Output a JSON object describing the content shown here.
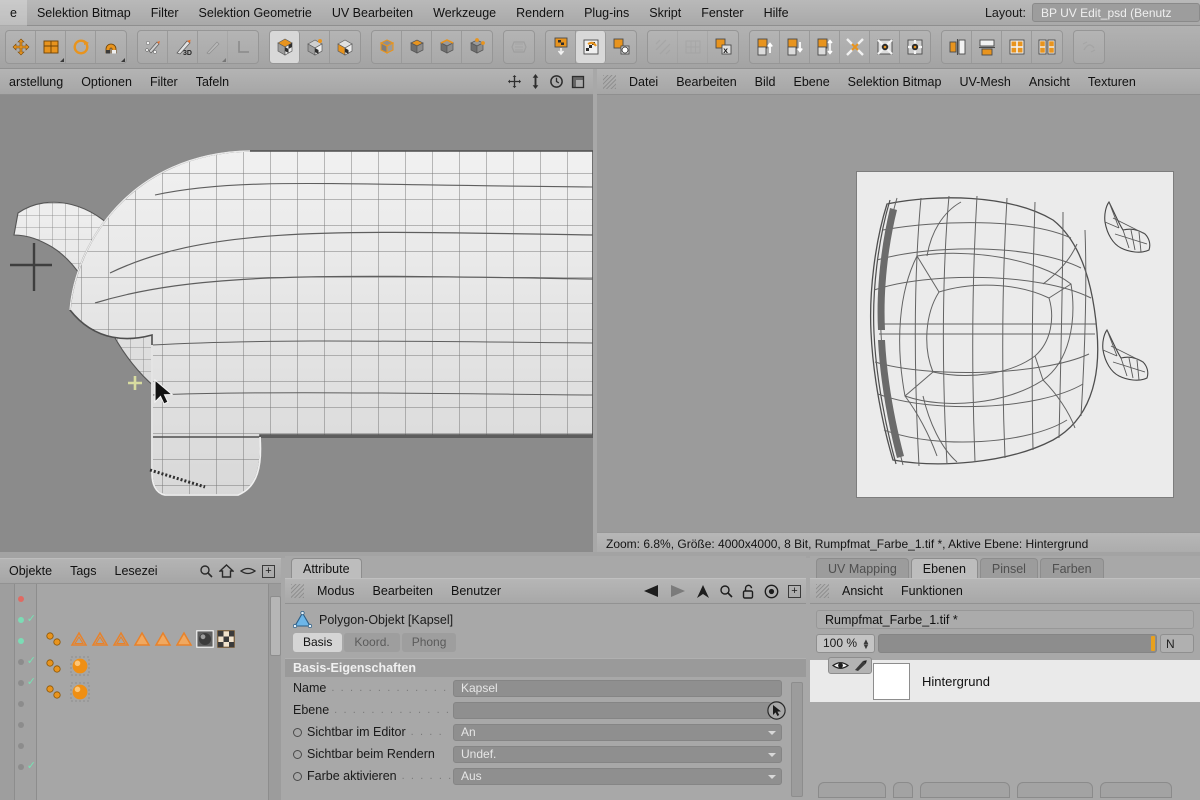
{
  "app": {
    "layout_label": "Layout:",
    "layout_value": "BP UV Edit_psd (Benutz"
  },
  "top_menu": {
    "items": [
      {
        "label": "e",
        "name": "menu-datei-truncated"
      },
      {
        "label": "Selektion Bitmap",
        "name": "menu-selektion-bitmap"
      },
      {
        "label": "Filter",
        "name": "menu-filter"
      },
      {
        "label": "Selektion Geometrie",
        "name": "menu-selektion-geometrie"
      },
      {
        "label": "UV Bearbeiten",
        "name": "menu-uv-bearbeiten"
      },
      {
        "label": "Werkzeuge",
        "name": "menu-werkzeuge"
      },
      {
        "label": "Rendern",
        "name": "menu-rendern"
      },
      {
        "label": "Plug-ins",
        "name": "menu-plugins"
      },
      {
        "label": "Skript",
        "name": "menu-skript"
      },
      {
        "label": "Fenster",
        "name": "menu-fenster"
      },
      {
        "label": "Hilfe",
        "name": "menu-hilfe"
      }
    ]
  },
  "icon_toolbar": {
    "groups": [
      {
        "name": "transform-tools",
        "buttons": [
          {
            "name": "move-tool-icon",
            "glyph": "move",
            "active": false
          },
          {
            "name": "scale-tool-icon",
            "glyph": "scale",
            "active": false,
            "corner": true
          },
          {
            "name": "rotate-tool-icon",
            "glyph": "rotate",
            "active": false
          },
          {
            "name": "magnet-tool-icon",
            "glyph": "magnet",
            "active": false,
            "corner": true
          }
        ]
      },
      {
        "name": "paint-tools",
        "buttons": [
          {
            "name": "selection-brush-icon",
            "glyph": "selbrush",
            "active": false
          },
          {
            "name": "paint-3d-brush-icon",
            "glyph": "brush3d",
            "active": false
          },
          {
            "name": "smudge-tool-icon",
            "glyph": "smudge",
            "active": false,
            "dim": true,
            "corner": true
          },
          {
            "name": "axis-tool-icon",
            "glyph": "axis",
            "active": false
          }
        ]
      },
      {
        "name": "uv-mode-tools",
        "buttons": [
          {
            "name": "texture-mode-icon",
            "glyph": "cubecheck-a",
            "active": true
          },
          {
            "name": "uv-polygon-mode-icon",
            "glyph": "cubecheck-b",
            "active": false
          },
          {
            "name": "uv-point-mode-icon",
            "glyph": "cubecheck-c",
            "active": false
          }
        ]
      },
      {
        "name": "component-mode-tools",
        "buttons": [
          {
            "name": "model-mode-icon",
            "glyph": "cube-model",
            "active": false
          },
          {
            "name": "polygon-mode-icon",
            "glyph": "cube-poly",
            "active": false
          },
          {
            "name": "edge-mode-icon",
            "glyph": "cube-edge",
            "active": false
          },
          {
            "name": "point-mode-icon",
            "glyph": "cube-point",
            "active": false
          }
        ]
      },
      {
        "name": "uv-mesh-tool",
        "buttons": [
          {
            "name": "uv-mesh-icon",
            "glyph": "uvmesh",
            "active": false,
            "dim": true
          }
        ]
      },
      {
        "name": "texture-apply-tools",
        "buttons": [
          {
            "name": "apply-texture-icon",
            "glyph": "apply-down",
            "active": false
          },
          {
            "name": "texture-swap-icon",
            "glyph": "tex-swap",
            "active": true
          },
          {
            "name": "texture-recycle-icon",
            "glyph": "tex-recycle",
            "active": false
          }
        ]
      },
      {
        "name": "layer-tools",
        "buttons": [
          {
            "name": "layer-pattern-icon",
            "glyph": "pattern",
            "active": false,
            "dim": true
          },
          {
            "name": "layer-grid-icon",
            "glyph": "grid",
            "active": false,
            "dim": true
          },
          {
            "name": "layer-delete-icon",
            "glyph": "layer-x",
            "active": false
          }
        ]
      },
      {
        "name": "uv-arrange-tools",
        "buttons": [
          {
            "name": "uv-move-up-icon",
            "glyph": "arr-up",
            "active": false
          },
          {
            "name": "uv-move-down-icon",
            "glyph": "arr-down",
            "active": false
          },
          {
            "name": "uv-move-updown-icon",
            "glyph": "arr-updown",
            "active": false
          },
          {
            "name": "uv-collapse-icon",
            "glyph": "collapse",
            "active": false
          },
          {
            "name": "uv-relax-icon",
            "glyph": "relax-a",
            "active": false
          },
          {
            "name": "uv-optimal-icon",
            "glyph": "relax-b",
            "active": false
          }
        ]
      },
      {
        "name": "uv-align-tools",
        "buttons": [
          {
            "name": "align-horizontal-icon",
            "glyph": "align-h",
            "active": false
          },
          {
            "name": "align-vertical-icon",
            "glyph": "align-v",
            "active": false
          },
          {
            "name": "distribute-grid-icon",
            "glyph": "dist-grid",
            "active": false
          },
          {
            "name": "distribute-columns-icon",
            "glyph": "dist-col",
            "active": false
          }
        ]
      },
      {
        "name": "uv-extras",
        "buttons": [
          {
            "name": "uv-extra-icon",
            "glyph": "extra",
            "active": false,
            "dim": true
          }
        ]
      }
    ]
  },
  "viewport": {
    "menu": [
      {
        "label": "arstellung",
        "name": "viewport-menu-darstellung"
      },
      {
        "label": "Optionen",
        "name": "viewport-menu-optionen"
      },
      {
        "label": "Filter",
        "name": "viewport-menu-filter"
      },
      {
        "label": "Tafeln",
        "name": "viewport-menu-tafeln"
      }
    ],
    "nav_icons": [
      {
        "name": "pan-viewport-icon"
      },
      {
        "name": "dolly-viewport-icon"
      },
      {
        "name": "rotate-viewport-icon"
      },
      {
        "name": "maximize-viewport-icon"
      }
    ]
  },
  "uv_editor": {
    "menu": [
      {
        "label": "Datei",
        "name": "uv-menu-datei"
      },
      {
        "label": "Bearbeiten",
        "name": "uv-menu-bearbeiten"
      },
      {
        "label": "Bild",
        "name": "uv-menu-bild"
      },
      {
        "label": "Ebene",
        "name": "uv-menu-ebene"
      },
      {
        "label": "Selektion Bitmap",
        "name": "uv-menu-selektion-bitmap"
      },
      {
        "label": "UV-Mesh",
        "name": "uv-menu-uv-mesh"
      },
      {
        "label": "Ansicht",
        "name": "uv-menu-ansicht"
      },
      {
        "label": "Texturen",
        "name": "uv-menu-texturen"
      }
    ],
    "status": "Zoom: 6.8%, Größe: 4000x4000, 8 Bit, Rumpfmat_Farbe_1.tif *, Aktive Ebene: Hintergrund",
    "zoom_percent": "6.8%",
    "image_size": "4000x4000",
    "bit_depth": "8 Bit",
    "file_name": "Rumpfmat_Farbe_1.tif *",
    "active_layer": "Hintergrund"
  },
  "object_manager": {
    "menu": [
      {
        "label": "Objekte",
        "name": "object-menu-objekte"
      },
      {
        "label": "Tags",
        "name": "object-menu-tags"
      },
      {
        "label": "Lesezei",
        "name": "object-menu-lesezeichen"
      }
    ],
    "icons": [
      {
        "name": "search-icon"
      },
      {
        "name": "home-icon"
      },
      {
        "name": "eye-icon"
      },
      {
        "name": "expand-icon"
      }
    ]
  },
  "attribute_manager": {
    "tabs": [
      {
        "label": "Attribute",
        "name": "tab-attribute",
        "active": true
      }
    ],
    "menu": [
      {
        "label": "Modus",
        "name": "attr-menu-modus"
      },
      {
        "label": "Bearbeiten",
        "name": "attr-menu-bearbeiten"
      },
      {
        "label": "Benutzer",
        "name": "attr-menu-benutzer"
      }
    ],
    "icons": [
      {
        "name": "back-arrow-icon"
      },
      {
        "name": "forward-arrow-icon"
      },
      {
        "name": "up-arrow-icon"
      },
      {
        "name": "search-icon"
      },
      {
        "name": "lock-icon"
      },
      {
        "name": "target-icon"
      },
      {
        "name": "expand-icon"
      }
    ],
    "object_title": "Polygon-Objekt [Kapsel]",
    "sub_tabs": [
      {
        "label": "Basis",
        "name": "subtab-basis",
        "active": true
      },
      {
        "label": "Koord.",
        "name": "subtab-koord",
        "active": false
      },
      {
        "label": "Phong",
        "name": "subtab-phong",
        "active": false
      }
    ],
    "group_header": "Basis-Eigenschaften",
    "properties": [
      {
        "label": "Name",
        "name": "prop-name",
        "value": "Kapsel",
        "kind": "text",
        "radio": false,
        "dots": true
      },
      {
        "label": "Ebene",
        "name": "prop-ebene",
        "value": "",
        "kind": "picker",
        "radio": false,
        "dots": true
      },
      {
        "label": "Sichtbar im Editor",
        "name": "prop-sichtbar-editor",
        "value": "An",
        "kind": "select",
        "radio": true,
        "dots": true
      },
      {
        "label": "Sichtbar beim Rendern",
        "name": "prop-sichtbar-rendern",
        "value": "Undef.",
        "kind": "select",
        "radio": true,
        "dots": false
      },
      {
        "label": "Farbe aktivieren",
        "name": "prop-farbe-aktivieren",
        "value": "Aus",
        "kind": "select",
        "radio": true,
        "dots": true
      }
    ]
  },
  "layer_manager": {
    "tabs": [
      {
        "label": "UV Mapping",
        "name": "tab-uv-mapping",
        "active": false
      },
      {
        "label": "Ebenen",
        "name": "tab-ebenen",
        "active": true
      },
      {
        "label": "Pinsel",
        "name": "tab-pinsel",
        "active": false
      },
      {
        "label": "Farben",
        "name": "tab-farben",
        "active": false
      }
    ],
    "menu": [
      {
        "label": "Ansicht",
        "name": "layer-menu-ansicht"
      },
      {
        "label": "Funktionen",
        "name": "layer-menu-funktionen"
      }
    ],
    "document": "Rumpfmat_Farbe_1.tif *",
    "opacity": "100 %",
    "blend_mode": "N",
    "layers": [
      {
        "name": "Hintergrund",
        "visible": true,
        "paintable": true
      }
    ]
  },
  "colors": {
    "chrome": "#a8a8a8",
    "chrome_light": "#b6b6b6",
    "viewport_bg": "#8b8b8b",
    "uv_canvas_bg": "#9b9b9b",
    "uv_image_bg": "#ebebeb",
    "accent_orange": "#e8941e",
    "highlight": "#d8d8d8",
    "crosshair": "#d8dca0",
    "layer_row": "#eaeaea"
  }
}
